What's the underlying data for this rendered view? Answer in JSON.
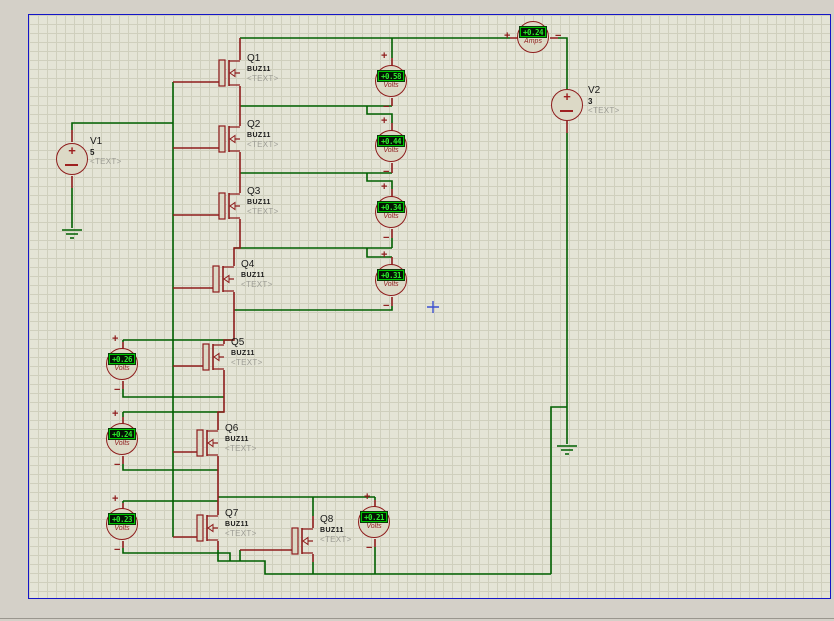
{
  "window": {
    "background": "#d4d0c8"
  },
  "sheet": {
    "border_color": "#1414c8",
    "grid_color": "#cfcfbd",
    "background": "#e4e4d6"
  },
  "colors": {
    "wire_green": "#006000",
    "component_maroon": "#8e1c1c",
    "lcd_background": "#041404",
    "lcd_text": "#2cee2c",
    "lcd_border": "#00c400",
    "placeholder_text": "#9c9c94",
    "cursor_blue": "#3b4fd0"
  },
  "glyphs": {
    "plus": "+",
    "minus": "−"
  },
  "transistors": [
    {
      "ref": "Q1",
      "part": "BUZ11",
      "placeholder": "<TEXT>"
    },
    {
      "ref": "Q2",
      "part": "BUZ11",
      "placeholder": "<TEXT>"
    },
    {
      "ref": "Q3",
      "part": "BUZ11",
      "placeholder": "<TEXT>"
    },
    {
      "ref": "Q4",
      "part": "BUZ11",
      "placeholder": "<TEXT>"
    },
    {
      "ref": "Q5",
      "part": "BUZ11",
      "placeholder": "<TEXT>"
    },
    {
      "ref": "Q6",
      "part": "BUZ11",
      "placeholder": "<TEXT>"
    },
    {
      "ref": "Q7",
      "part": "BUZ11",
      "placeholder": "<TEXT>"
    },
    {
      "ref": "Q8",
      "part": "BUZ11",
      "placeholder": "<TEXT>"
    }
  ],
  "sources": [
    {
      "ref": "V1",
      "value": "5",
      "placeholder": "<TEXT>"
    },
    {
      "ref": "V2",
      "value": "3",
      "placeholder": "<TEXT>"
    }
  ],
  "meters": {
    "ammeter": {
      "reading": "+0.24",
      "unit": "Amps"
    },
    "voltmeters": [
      {
        "reading": "+0.58",
        "unit": "Volts"
      },
      {
        "reading": "+0.44",
        "unit": "Volts"
      },
      {
        "reading": "+0.34",
        "unit": "Volts"
      },
      {
        "reading": "+0.31",
        "unit": "Volts"
      },
      {
        "reading": "+0.26",
        "unit": "Volts"
      },
      {
        "reading": "+0.24",
        "unit": "Volts"
      },
      {
        "reading": "+0.23",
        "unit": "Volts"
      },
      {
        "reading": "+0.21",
        "unit": "Volts"
      }
    ]
  }
}
